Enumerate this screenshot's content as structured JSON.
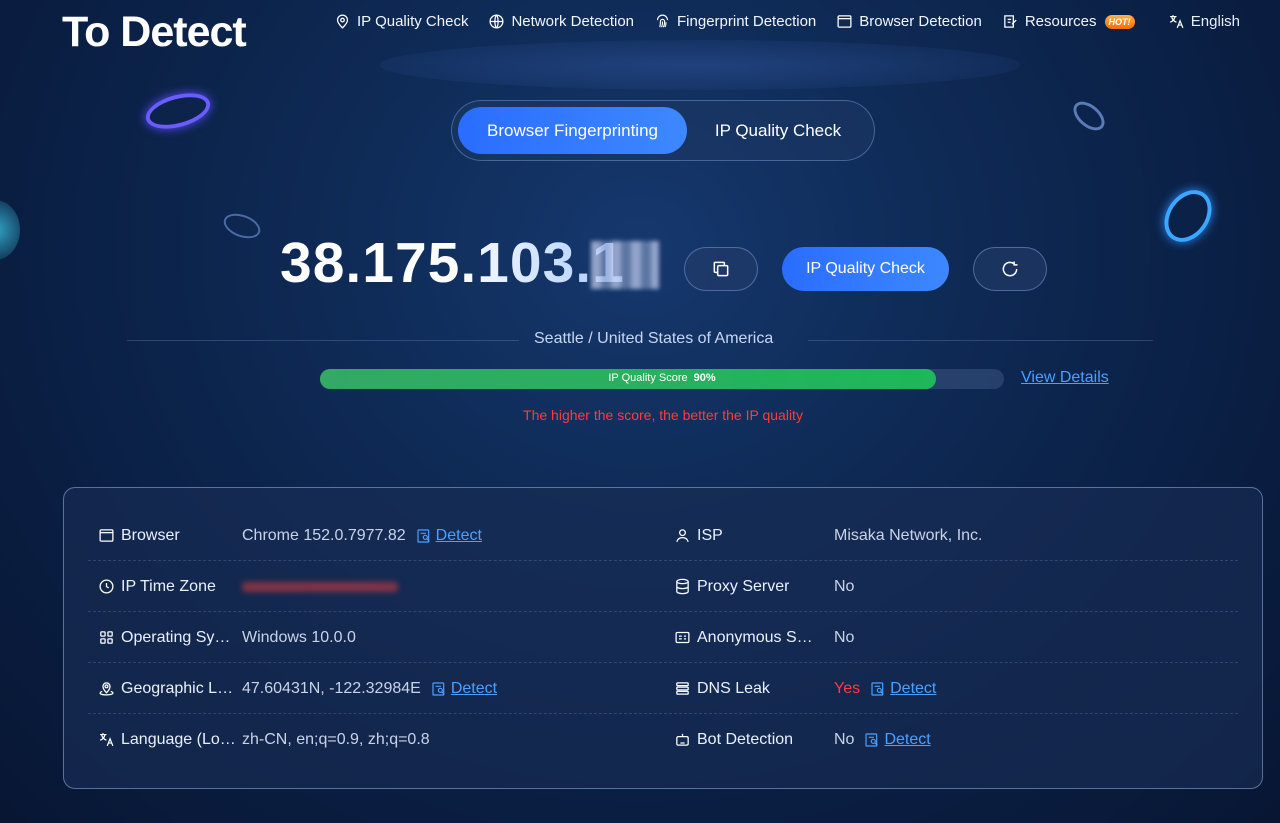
{
  "header": {
    "logo": "To Detect",
    "nav": [
      {
        "label": "IP Quality Check",
        "icon": "location-pin-icon"
      },
      {
        "label": "Network Detection",
        "icon": "globe-icon"
      },
      {
        "label": "Fingerprint Detection",
        "icon": "fingerprint-icon"
      },
      {
        "label": "Browser Detection",
        "icon": "browser-window-icon"
      },
      {
        "label": "Resources",
        "icon": "edit-doc-icon",
        "badge": "HOT!"
      }
    ],
    "language": "English"
  },
  "tabs": {
    "active": "Browser Fingerprinting",
    "inactive": "IP Quality Check"
  },
  "ip": {
    "address": "38.175.103.1",
    "check_button": "IP Quality Check",
    "location": "Seattle / United States of America",
    "score_label": "IP Quality Score",
    "score_value": "90%",
    "score_fraction": 0.9,
    "view_details": "View Details",
    "hint": "The higher the score, the better the IP quality"
  },
  "info": {
    "left": [
      {
        "label": "Browser",
        "value": "Chrome 152.0.7977.82",
        "detect": "Detect"
      },
      {
        "label": "IP Time Zone",
        "value": ""
      },
      {
        "label": "Operating Sy…",
        "value": "Windows 10.0.0"
      },
      {
        "label": "Geographic L…",
        "value": "47.60431N, -122.32984E",
        "detect": "Detect"
      },
      {
        "label": "Language (Lo…",
        "value": "zh-CN, en;q=0.9, zh;q=0.8"
      }
    ],
    "right": [
      {
        "label": "ISP",
        "value": "Misaka Network, Inc."
      },
      {
        "label": "Proxy Server",
        "value": "No"
      },
      {
        "label": "Anonymous Ser…",
        "value": "No"
      },
      {
        "label": "DNS Leak",
        "value": "Yes",
        "detect": "Detect"
      },
      {
        "label": "Bot Detection",
        "value": "No",
        "detect": "Detect"
      }
    ]
  },
  "colors": {
    "accent": "#2a6dff",
    "link": "#4aa0ff",
    "warning": "#ff3b3b",
    "score_fill": "#34a866"
  }
}
